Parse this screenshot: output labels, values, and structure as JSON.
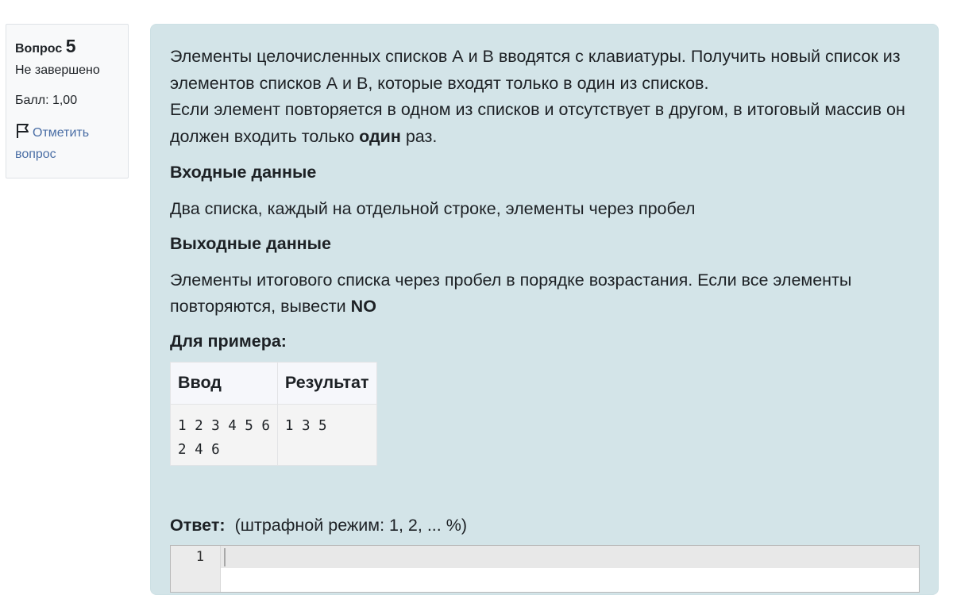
{
  "info": {
    "question_label": "Вопрос",
    "question_number": "5",
    "state": "Не завершено",
    "grade": "Балл: 1,00",
    "flag_label_1": "Отметить",
    "flag_label_2": "вопрос"
  },
  "question": {
    "para1": "Элементы целочисленных списков А и В вводятся с клавиатуры. Получить новый список из элементов списков А и В, которые входят только в один из списков.",
    "para2_before": "Если элемент повторяется в одном из списков и отсутствует в другом, в итоговый массив он должен входить только ",
    "para2_bold": "один",
    "para2_after": " раз.",
    "input_heading": "Входные данные",
    "input_text": "Два списка, каждый на отдельной строке, элементы через пробел",
    "output_heading": "Выходные данные",
    "output_before": "Элементы итогового списка через пробел в порядке возрастания. Если все элементы повторяются, вывести ",
    "output_bold": "NO",
    "example_heading": "Для примера:",
    "table": {
      "headers": [
        "Ввод",
        "Результат"
      ],
      "rows": [
        {
          "input": "1 2 3 4 5 6\n2 4 6",
          "result": "1 3 5"
        }
      ]
    }
  },
  "answer": {
    "label": "Ответ:",
    "penalty": "(штрафной режим: 1, 2, ... %)",
    "editor_line": "1"
  },
  "colors": {
    "content_bg": "#d3e4e8",
    "link": "#4a6ea5"
  },
  "icons": [
    "flag-icon"
  ]
}
